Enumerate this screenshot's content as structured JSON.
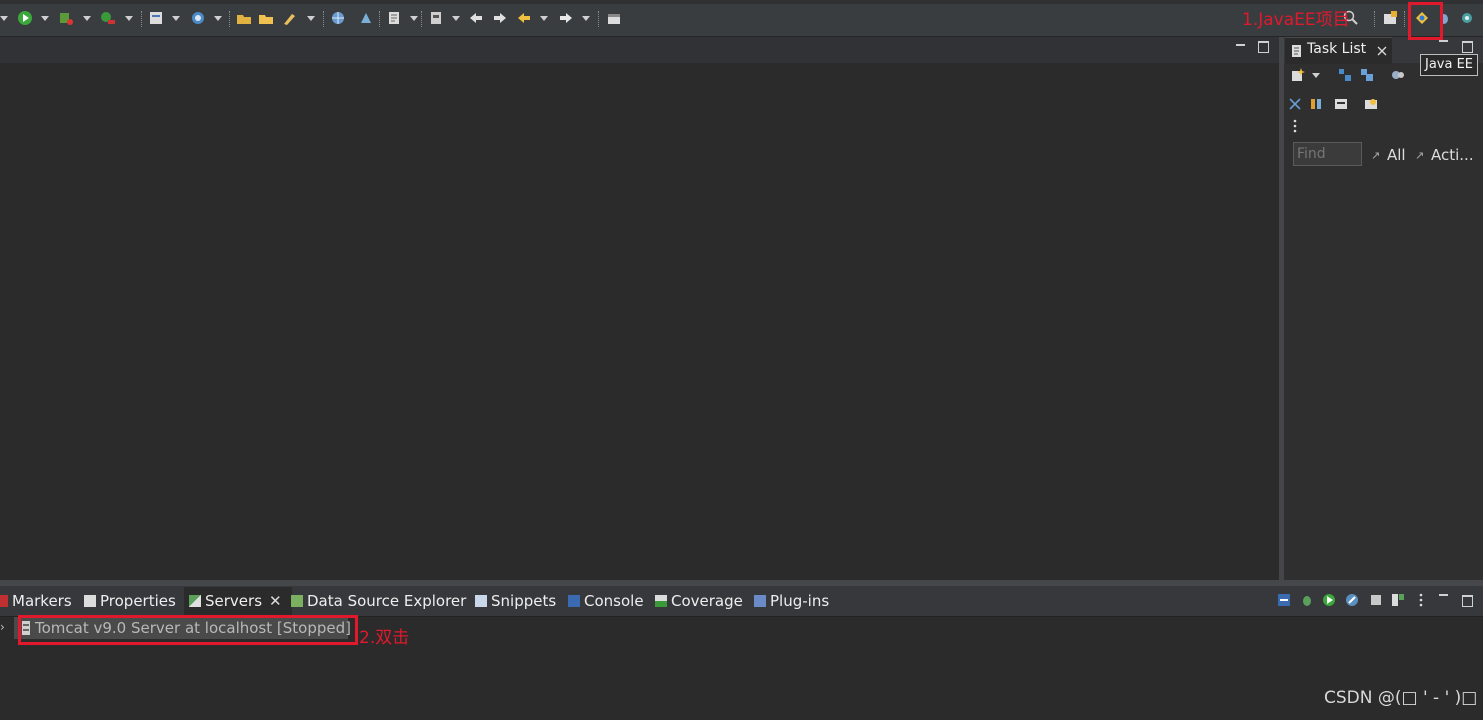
{
  "toolbar": {
    "icons": [
      "run-icon",
      "debug-icon",
      "coverage-icon",
      "new-server-icon",
      "open-type-icon",
      "open-task-icon",
      "open-folder-icon",
      "search-tool-icon",
      "web-browser-icon",
      "external-tools-icon",
      "annotation-icon",
      "pin-editor-icon",
      "prev-annotation-icon",
      "next-annotation-icon",
      "back-icon",
      "forward-icon",
      "new-window-icon"
    ],
    "perspectives": [
      "open-perspective-icon",
      "java-ee-perspective-icon",
      "debug-perspective-icon",
      "java-perspective-icon"
    ]
  },
  "task_list": {
    "tab_label": "Task List",
    "find_placeholder": "Find",
    "filter_all": "All",
    "filter_active": "Acti..."
  },
  "tooltip": {
    "text": "Java EE"
  },
  "bottom_tabs": [
    {
      "label": "Markers"
    },
    {
      "label": "Properties"
    },
    {
      "label": "Servers",
      "active": true
    },
    {
      "label": "Data Source Explorer"
    },
    {
      "label": "Snippets"
    },
    {
      "label": "Console"
    },
    {
      "label": "Coverage"
    },
    {
      "label": "Plug-ins"
    }
  ],
  "servers": {
    "row_label": "Tomcat v9.0 Server at localhost  [Stopped]"
  },
  "annotations": {
    "step1": "1.JavaEE项目",
    "step2": "2.双击",
    "color": "#e0192d"
  },
  "watermark": "CSDN @(□ ' - ' )□"
}
